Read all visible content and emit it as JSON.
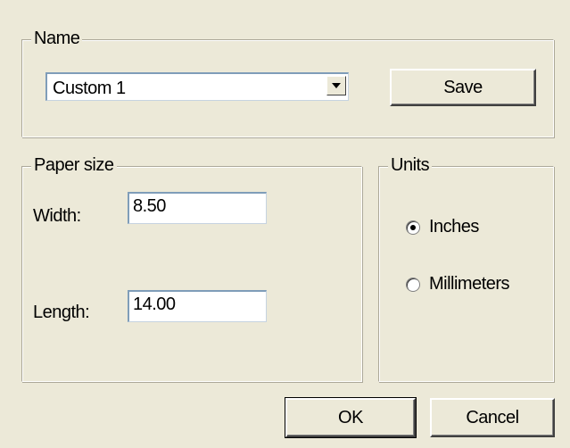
{
  "name_group": {
    "legend": "Name",
    "combo_value": "Custom 1",
    "save_label": "Save"
  },
  "paper_size": {
    "legend": "Paper size",
    "width_label": "Width:",
    "width_value": "8.50",
    "length_label": "Length:",
    "length_value": "14.00"
  },
  "units": {
    "legend": "Units",
    "options": [
      {
        "label": "Inches",
        "selected": true
      },
      {
        "label": "Millimeters",
        "selected": false
      }
    ]
  },
  "buttons": {
    "ok_label": "OK",
    "cancel_label": "Cancel"
  },
  "icons": {
    "combo_arrow": "chevron-down-icon"
  }
}
